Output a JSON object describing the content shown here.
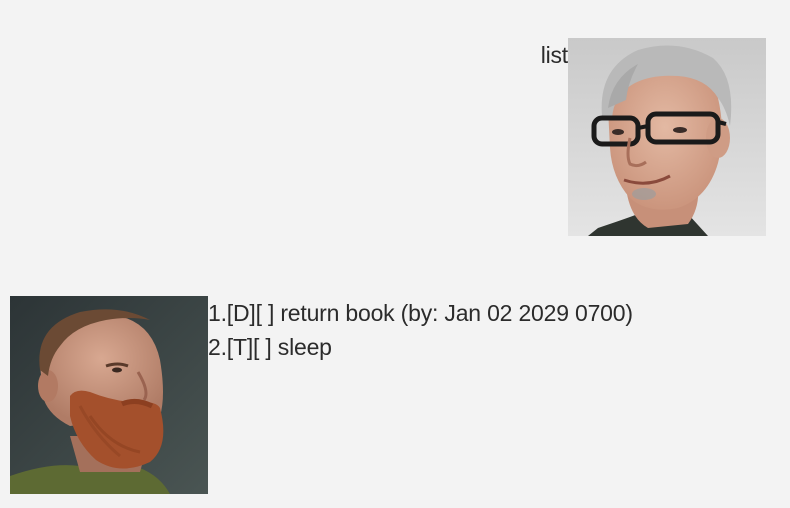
{
  "user": {
    "message": "list",
    "avatar_icon": "bald-man-with-glasses-avatar"
  },
  "bot": {
    "lines": [
      "1.[D][ ] return book (by: Jan 02 2029 0700)",
      "2.[T][ ] sleep"
    ],
    "avatar_icon": "bearded-man-avatar"
  },
  "colors": {
    "background": "#f3f3f3",
    "text": "#2b2b2b"
  }
}
